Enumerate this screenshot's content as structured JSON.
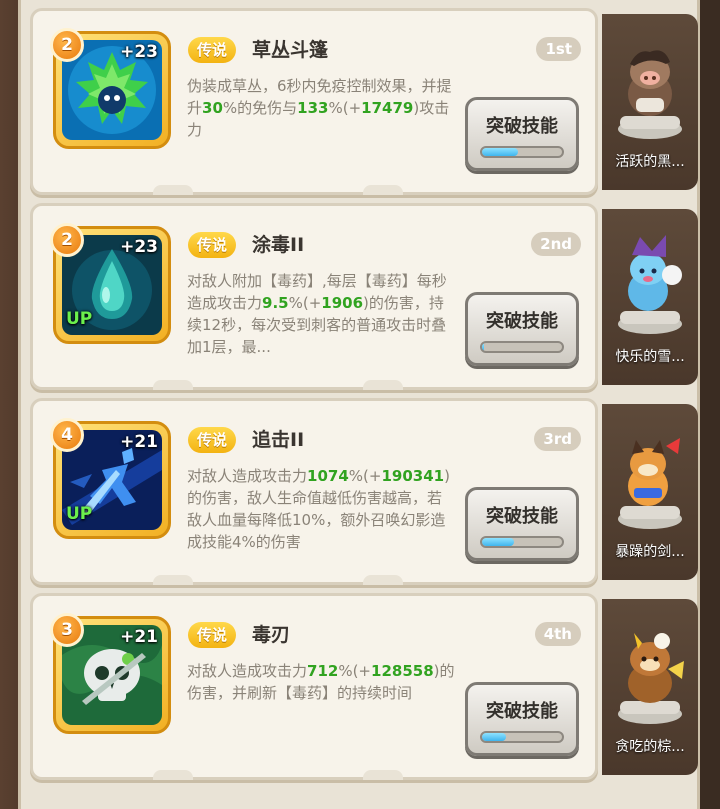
{
  "skills": [
    {
      "level": "2",
      "plus": "+23",
      "up": "",
      "tag": "传说",
      "name": "草丛斗篷",
      "rank": "1st",
      "desc": [
        {
          "t": "伪装成草丛，6秒内免疫控制效果，并提升"
        },
        {
          "t": "30",
          "hl": true
        },
        {
          "t": "%的免伤与"
        },
        {
          "t": "133",
          "hl": true
        },
        {
          "t": "%(+"
        },
        {
          "t": "17479",
          "hl": true
        },
        {
          "t": ")攻击力"
        }
      ],
      "button": "突破技能",
      "progress": 0.45,
      "hero": "活跃的黑...",
      "icon": "bush-cloak-icon"
    },
    {
      "level": "2",
      "plus": "+23",
      "up": "UP",
      "tag": "传说",
      "name": "涂毒II",
      "rank": "2nd",
      "desc": [
        {
          "t": "对敌人附加【毒药】,每层【毒药】每秒造成攻击力"
        },
        {
          "t": "9.5",
          "hl": true
        },
        {
          "t": "%(+"
        },
        {
          "t": "1906",
          "hl": true
        },
        {
          "t": ")的伤害，持续12秒，每次受到刺客的普通攻击时叠加1层，最..."
        }
      ],
      "button": "突破技能",
      "progress": 0.03,
      "hero": "快乐的雪...",
      "icon": "poison-drop-icon"
    },
    {
      "level": "4",
      "plus": "+21",
      "up": "UP",
      "tag": "传说",
      "name": "追击II",
      "rank": "3rd",
      "desc": [
        {
          "t": "对敌人造成攻击力"
        },
        {
          "t": "1074",
          "hl": true
        },
        {
          "t": "%(+"
        },
        {
          "t": "190341",
          "hl": true
        },
        {
          "t": ")的伤害，敌人生命值越低伤害越高，若敌人血量每降低10%，额外召唤幻影造成技能4%的伤害"
        }
      ],
      "button": "突破技能",
      "progress": 0.4,
      "hero": "暴躁的剑...",
      "icon": "pursuit-phantom-icon"
    },
    {
      "level": "3",
      "plus": "+21",
      "up": "",
      "tag": "传说",
      "name": "毒刃",
      "rank": "4th",
      "desc": [
        {
          "t": "对敌人造成攻击力"
        },
        {
          "t": "712",
          "hl": true
        },
        {
          "t": "%(+"
        },
        {
          "t": "128558",
          "hl": true
        },
        {
          "t": ")的伤害，并刷新【毒药】的持续时间"
        }
      ],
      "button": "突破技能",
      "progress": 0.3,
      "hero": "贪吃的棕...",
      "icon": "poison-skull-icon"
    }
  ],
  "colors": {
    "highlight": "#31a320",
    "tag": "#f3b312",
    "progress": "#3fb5ee"
  }
}
